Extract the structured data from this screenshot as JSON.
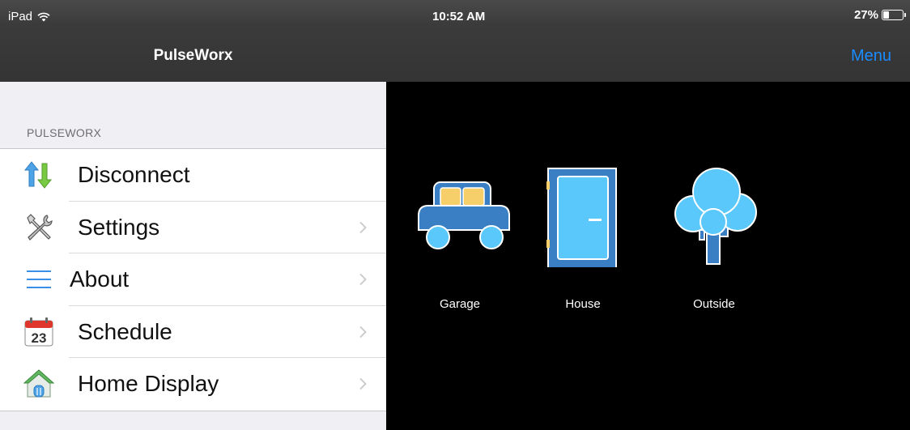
{
  "status_bar": {
    "device": "iPad",
    "time": "10:52 AM",
    "battery": "27%",
    "battery_level": 0.27
  },
  "sidebar": {
    "title": "PulseWorx",
    "section_header": "PULSEWORX",
    "items": [
      {
        "label": "Disconnect",
        "icon": "arrows-icon",
        "chevron": false
      },
      {
        "label": "Settings",
        "icon": "tools-icon",
        "chevron": true
      },
      {
        "label": "About",
        "icon": "hamburger-icon",
        "chevron": true
      },
      {
        "label": "Schedule",
        "icon": "calendar-icon",
        "icon_text": "23",
        "chevron": true
      },
      {
        "label": "Home Display",
        "icon": "home-icon",
        "chevron": true
      }
    ]
  },
  "detail": {
    "menu_label": "Menu",
    "tiles": [
      {
        "label": "Garage",
        "icon": "car-icon"
      },
      {
        "label": "House",
        "icon": "door-icon"
      },
      {
        "label": "Outside",
        "icon": "tree-icon"
      }
    ]
  },
  "colors": {
    "accent": "#1a8cff",
    "tile_fill": "#5ac8fa",
    "tile_stroke": "#2b6cb0"
  }
}
